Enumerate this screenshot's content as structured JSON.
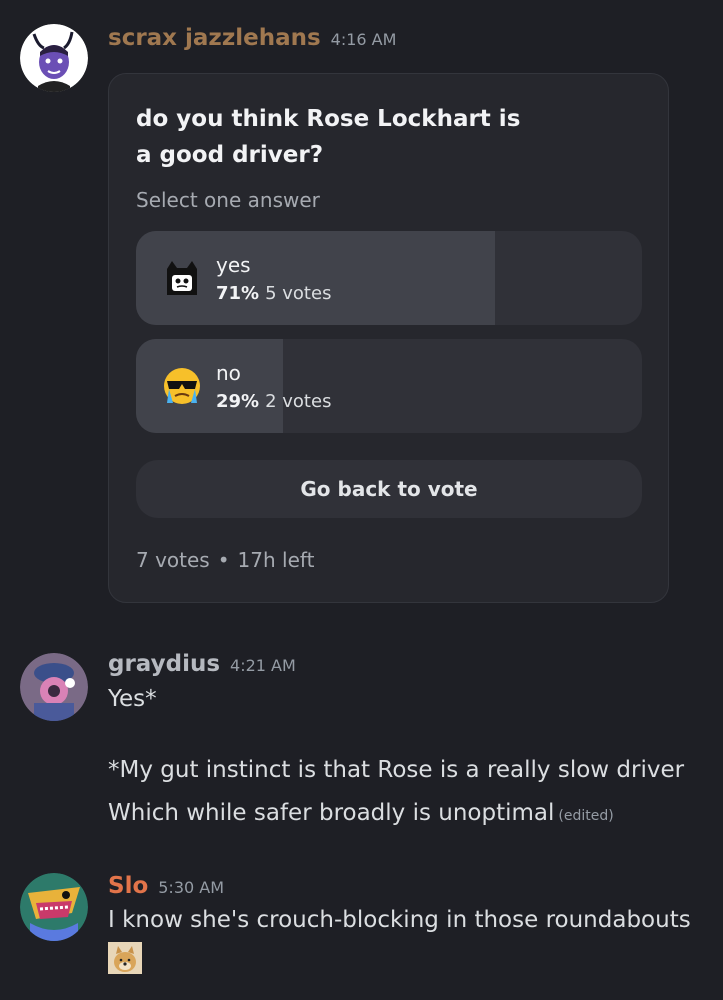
{
  "messages": [
    {
      "username": "scrax jazzlehans",
      "time": "4:16 AM",
      "name_color": "#a07850",
      "poll": {
        "question": "do you think Rose Lockhart is a good driver?",
        "instruction": "Select one answer",
        "options": [
          {
            "label": "yes",
            "percent": "71%",
            "votes": "5 votes",
            "fraction": 0.71,
            "emoji": "cat-girl-emoji"
          },
          {
            "label": "no",
            "percent": "29%",
            "votes": "2 votes",
            "fraction": 0.29,
            "emoji": "crying-sunglasses-emoji"
          }
        ],
        "back_button": "Go back to vote",
        "total_votes": "7 votes",
        "separator": "•",
        "time_left": "17h left"
      }
    },
    {
      "username": "graydius",
      "time": "4:21 AM",
      "name_color": "#b6b9c0",
      "lines": [
        "Yes*",
        "*My gut instinct is that Rose is a really slow driver",
        "Which while safer broadly is unoptimal"
      ],
      "edited": "(edited)"
    },
    {
      "username": "Slo",
      "time": "5:30 AM",
      "name_color": "#e2744a",
      "lines": [
        "I know she's crouch-blocking in those roundabouts"
      ],
      "emoji": "doge-emoji"
    }
  ]
}
